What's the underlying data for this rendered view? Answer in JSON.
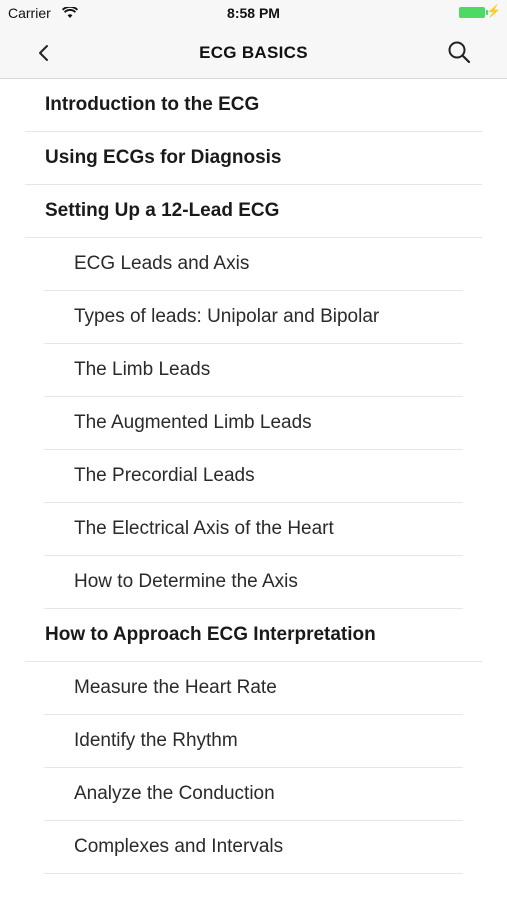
{
  "status": {
    "carrier": "Carrier",
    "time": "8:58 PM"
  },
  "nav": {
    "title": "ECG BASICS",
    "back_icon": "chevron-left-icon",
    "search_icon": "search-icon"
  },
  "items": [
    {
      "label": "Introduction to the ECG",
      "type": "section"
    },
    {
      "label": "Using ECGs for Diagnosis",
      "type": "section"
    },
    {
      "label": "Setting Up a 12-Lead ECG",
      "type": "section"
    },
    {
      "label": "ECG Leads and Axis",
      "type": "sub"
    },
    {
      "label": "Types of leads: Unipolar and Bipolar",
      "type": "sub"
    },
    {
      "label": "The Limb Leads",
      "type": "sub"
    },
    {
      "label": "The Augmented Limb Leads",
      "type": "sub"
    },
    {
      "label": "The Precordial Leads",
      "type": "sub"
    },
    {
      "label": "The Electrical Axis of the Heart",
      "type": "sub"
    },
    {
      "label": "How to Determine the Axis",
      "type": "sub"
    },
    {
      "label": "How to Approach ECG Interpretation",
      "type": "section"
    },
    {
      "label": "Measure the Heart Rate",
      "type": "sub"
    },
    {
      "label": "Identify the Rhythm",
      "type": "sub"
    },
    {
      "label": "Analyze the Conduction",
      "type": "sub"
    },
    {
      "label": "Complexes and Intervals",
      "type": "sub"
    }
  ]
}
